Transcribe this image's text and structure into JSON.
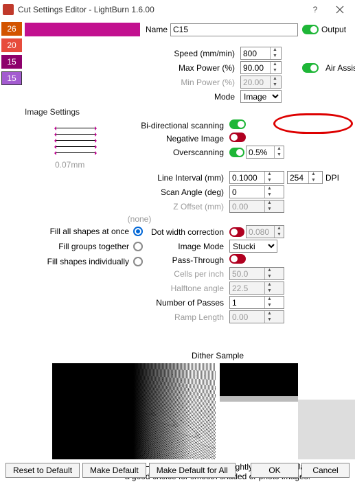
{
  "window": {
    "title": "Cut Settings Editor - LightBurn 1.6.00"
  },
  "layers": [
    {
      "label": "26"
    },
    {
      "label": "20"
    },
    {
      "label": "15"
    },
    {
      "label": "15"
    }
  ],
  "top": {
    "name_label": "Name",
    "name_value": "C15",
    "output_label": "Output"
  },
  "basic": {
    "speed_label": "Speed (mm/min)",
    "speed_value": "800",
    "maxpower_label": "Max Power (%)",
    "maxpower_value": "90.00",
    "minpower_label": "Min Power (%)",
    "minpower_value": "20.00",
    "mode_label": "Mode",
    "mode_value": "Image",
    "airassist_label": "Air Assist"
  },
  "image_settings_label": "Image Settings",
  "img": {
    "bidir_label": "Bi-directional scanning",
    "neg_label": "Negative Image",
    "overscan_label": "Overscanning",
    "overscan_value": "0.5%",
    "overscan_mm": "0.07mm",
    "lineint_label": "Line Interval (mm)",
    "lineint_value": "0.1000",
    "dpi_value": "254",
    "dpi_label": "DPI",
    "scanangle_label": "Scan Angle (deg)",
    "scanangle_value": "0",
    "zoffset_label": "Z Offset (mm)",
    "zoffset_value": "0.00",
    "zoffset_none": "(none)",
    "dotcorr_label": "Dot width correction",
    "dotcorr_value": "0.080",
    "imagemode_label": "Image Mode",
    "imagemode_value": "Stucki",
    "passthrough_label": "Pass-Through",
    "cpi_label": "Cells per inch",
    "cpi_value": "50.0",
    "halftone_label": "Halftone angle",
    "halftone_value": "22.5",
    "passes_label": "Number of Passes",
    "passes_value": "1",
    "ramp_label": "Ramp Length",
    "ramp_value": "0.00"
  },
  "fill": {
    "all_label": "Fill all shapes at once",
    "groups_label": "Fill groups together",
    "indiv_label": "Fill shapes individually"
  },
  "dither": {
    "title": "Dither Sample",
    "caption1": "Stucki: High quality dithering. Slightly faster than Jarvis",
    "caption2": "a good choice for smooth shaded or photo images."
  },
  "footer": {
    "reset": "Reset to Default",
    "makedef": "Make Default",
    "makedefall": "Make Default for All",
    "ok": "OK",
    "cancel": "Cancel"
  }
}
